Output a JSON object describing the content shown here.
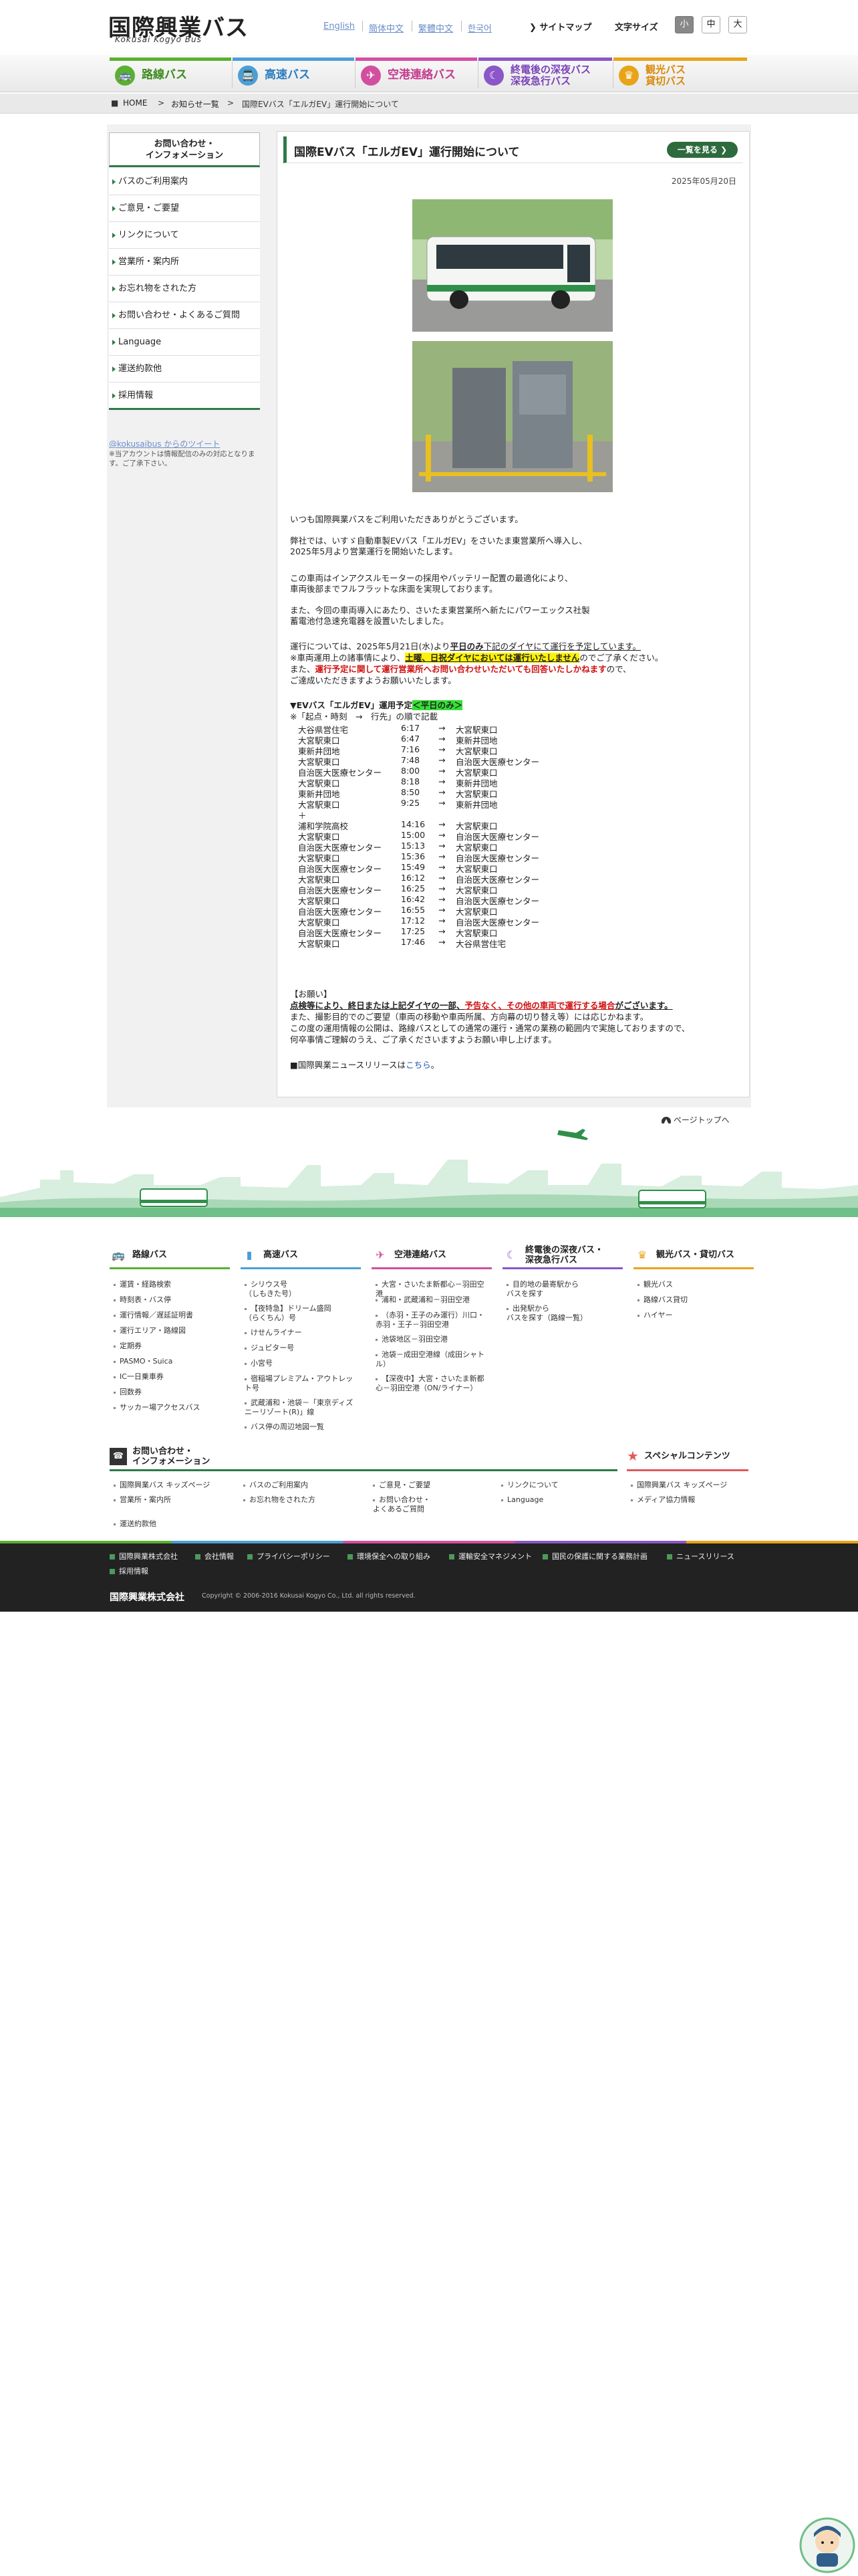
{
  "header": {
    "logo_jp": "国際興業バス",
    "logo_en": "Kokusai Kogyo Bus",
    "langs": [
      "English",
      "簡体中文",
      "繁體中文",
      "한국어"
    ],
    "sitemap": "サイトマップ",
    "font_size_label": "文字サイズ",
    "font_sizes": [
      "小",
      "中",
      "大"
    ]
  },
  "gnav": [
    {
      "label": "路線バス",
      "color": "#5ab030",
      "icon": "bus-icon"
    },
    {
      "label": "高速バス",
      "color": "#4a9fd8",
      "icon": "highway-bus-icon"
    },
    {
      "label": "空港連絡バス",
      "color": "#d24fa0",
      "icon": "airplane-icon"
    },
    {
      "label": "終電後の深夜バス\n深夜急行バス",
      "color": "#8a56c8",
      "icon": "moon-icon"
    },
    {
      "label": "観光バス\n貸切バス",
      "color": "#e8a418",
      "icon": "sightseeing-icon"
    }
  ],
  "breadcrumb": {
    "home": "HOME",
    "news": "お知らせ一覧",
    "current": "国際EVバス「エルガEV」運行開始について"
  },
  "sidebar": {
    "heading": "お問い合わせ・\nインフォメーション",
    "items": [
      "バスのご利用案内",
      "ご意見・ご要望",
      "リンクについて",
      "営業所・案内所",
      "お忘れ物をされた方",
      "お問い合わせ・よくあるご質問",
      "Language",
      "運送約款他",
      "採用情報"
    ],
    "twitter_link": "@kokusaibus からのツイート",
    "twitter_note": "※当アカウントは情報配信のみの対応となります。ご了承下さい。"
  },
  "article": {
    "title": "国際EVバス「エルガEV」運行開始について",
    "list_button": "一覧を見る",
    "date": "2025年05月20日",
    "p1": "いつも国際興業バスをご利用いただきありがとうございます。",
    "p2a": "弊社では、いすゞ自動車製EVバス「エルガEV」をさいたま東営業所へ導入し、",
    "p2b": "2025年5月より営業運行を開始いたします。",
    "p3a": "この車両はインアクスルモーターの採用やバッテリー配置の最適化により、",
    "p3b": "車両後部までフルフラットな床面を実現しております。",
    "p4a": "また、今回の車両導入にあたり、さいたま東営業所へ新たにパワーエックス社製",
    "p4b": "蓄電池付急速充電器を設置いたしました。",
    "p5a_1": "運行については、2025年5月21日(水)より",
    "p5a_2": "平日のみ",
    "p5a_3": "下記のダイヤにて運行を予定しています。",
    "p5b_1": "※車両運用上の諸事情により、",
    "p5b_2": "土曜、日祝ダイヤにおいては",
    "p5b_3": "運行いたしません",
    "p5b_4": "のでご了承ください。",
    "p5c_1": "また、",
    "p5c_2": "運行予定に関して運行営業所へお問い合わせいただいても回答いたしかねます",
    "p5c_3": "ので、",
    "p5d": "ご達成いただきますようお願いいたします。",
    "sched_title_1": "▼EVバス「エルガEV」運用予定",
    "sched_title_2": "＜平日のみ＞",
    "sched_note": "※「起点・時刻　→　行先」の順で記載",
    "schedule_am": [
      [
        "大谷県営住宅",
        "6:17",
        "大宮駅東口"
      ],
      [
        "大宮駅東口",
        "6:47",
        "東新井団地"
      ],
      [
        "東新井団地",
        "7:16",
        "大宮駅東口"
      ],
      [
        "大宮駅東口",
        "7:48",
        "自治医大医療センター"
      ],
      [
        "自治医大医療センター",
        "8:00",
        "大宮駅東口"
      ],
      [
        "大宮駅東口",
        "8:18",
        "東新井団地"
      ],
      [
        "東新井団地",
        "8:50",
        "大宮駅東口"
      ],
      [
        "大宮駅東口",
        "9:25",
        "東新井団地"
      ]
    ],
    "schedule_sep": "＋",
    "schedule_pm": [
      [
        "浦和学院高校",
        "14:16",
        "大宮駅東口"
      ],
      [
        "大宮駅東口",
        "15:00",
        "自治医大医療センター"
      ],
      [
        "自治医大医療センター",
        "15:13",
        "大宮駅東口"
      ],
      [
        "大宮駅東口",
        "15:36",
        "自治医大医療センター"
      ],
      [
        "自治医大医療センター",
        "15:49",
        "大宮駅東口"
      ],
      [
        "大宮駅東口",
        "16:12",
        "自治医大医療センター"
      ],
      [
        "自治医大医療センター",
        "16:25",
        "大宮駅東口"
      ],
      [
        "大宮駅東口",
        "16:42",
        "自治医大医療センター"
      ],
      [
        "自治医大医療センター",
        "16:55",
        "大宮駅東口"
      ],
      [
        "大宮駅東口",
        "17:12",
        "自治医大医療センター"
      ],
      [
        "自治医大医療センター",
        "17:25",
        "大宮駅東口"
      ],
      [
        "大宮駅東口",
        "17:46",
        "大谷県営住宅"
      ]
    ],
    "notice_head": "【お願い】",
    "notice1_1": "点検等により、終日または上記ダイヤの一部、",
    "notice1_2": "予告なく、その他の車両で運行する場合",
    "notice1_3": "がございます。",
    "notice2": "また、撮影目的でのご要望（車両の移動や車両所属、方向幕の切り替え等）には応じかねます。",
    "notice3": "この度の運用情報の公開は、路線バスとしての通常の運行・通常の業務の範囲内で実施しておりますので、",
    "notice4": "何卒事情ご理解のうえ、ご了承くださいますようお願い申し上げます。",
    "press_1": "■国際興業ニュースリリースは",
    "press_link": "こちら",
    "press_2": "。"
  },
  "pagetop": "ページトップへ",
  "footer": {
    "cols": [
      {
        "title": "路線バス",
        "color": "#5ab030",
        "icon": "bus-icon",
        "links": [
          "運賃・経路検索",
          "時刻表・バス停",
          "運行情報／遅延証明書",
          "運行エリア・路線図",
          "定期券",
          "PASMO・Suica",
          "IC一日乗車券",
          "回数券",
          "サッカー場アクセスバス"
        ]
      },
      {
        "title": "高速バス",
        "color": "#4a9fd8",
        "icon": "highway-bus-icon",
        "links": [
          "シリウス号\n（しもきた号）",
          "【夜特急】ドリーム盛岡\n（らくちん）号",
          "けせんライナー",
          "ジュピター号",
          "小宮号",
          "宿稲場プレミアム・アウトレット号",
          "武蔵浦和・池袋－「東京ディズニーリゾート(R)」線",
          "バス停の周辺地図一覧"
        ]
      },
      {
        "title": "空港連絡バス",
        "color": "#d24fa0",
        "icon": "airplane-icon",
        "links": [
          "大宮・さいたま新都心－羽田空港",
          "浦和・武蔵浦和－羽田空港",
          "（赤羽・王子のみ運行）川口・赤羽・王子－羽田空港",
          "池袋地区－羽田空港",
          "池袋－成田空港線（成田シャトル）",
          "【深夜中】大宮・さいたま新都心－羽田空港（ON/ライナー）"
        ]
      },
      {
        "title": "終電後の深夜バス・\n深夜急行バス",
        "color": "#8a56c8",
        "icon": "moon-icon",
        "links": [
          "目的地の最寄駅から\nバスを探す",
          "出発駅から\nバスを探す（路線一覧）"
        ]
      },
      {
        "title": "観光バス・貸切バス",
        "color": "#e8a418",
        "icon": "sightseeing-icon",
        "links": [
          "観光バス",
          "路線バス貸切",
          "ハイヤー"
        ]
      }
    ],
    "info_title": "お問い合わせ・\nインフォメーション",
    "special_title": "スペシャルコンテンツ",
    "info_links": [
      "国際興業バス キッズページ",
      "バスのご利用案内",
      "ご意見・ご要望",
      "リンクについて",
      "営業所・案内所",
      "お忘れ物をされた方",
      "お問い合わせ・\nよくあるご質問",
      "Language",
      "運送約款他"
    ],
    "special_links": [
      "国際興業バス キッズページ",
      "メディア協力情報"
    ],
    "bottom_links": [
      "国際興業株式会社",
      "会社情報",
      "プライバシーポリシー",
      "環境保全への取り組み",
      "運輸安全マネジメント",
      "国民の保護に関する業務計画",
      "ニュースリリース",
      "採用情報"
    ],
    "company": "国際興業株式会社",
    "copyright": "Copyright © 2006-2016 Kokusai Kogyo Co., Ltd. all rights reserved."
  }
}
